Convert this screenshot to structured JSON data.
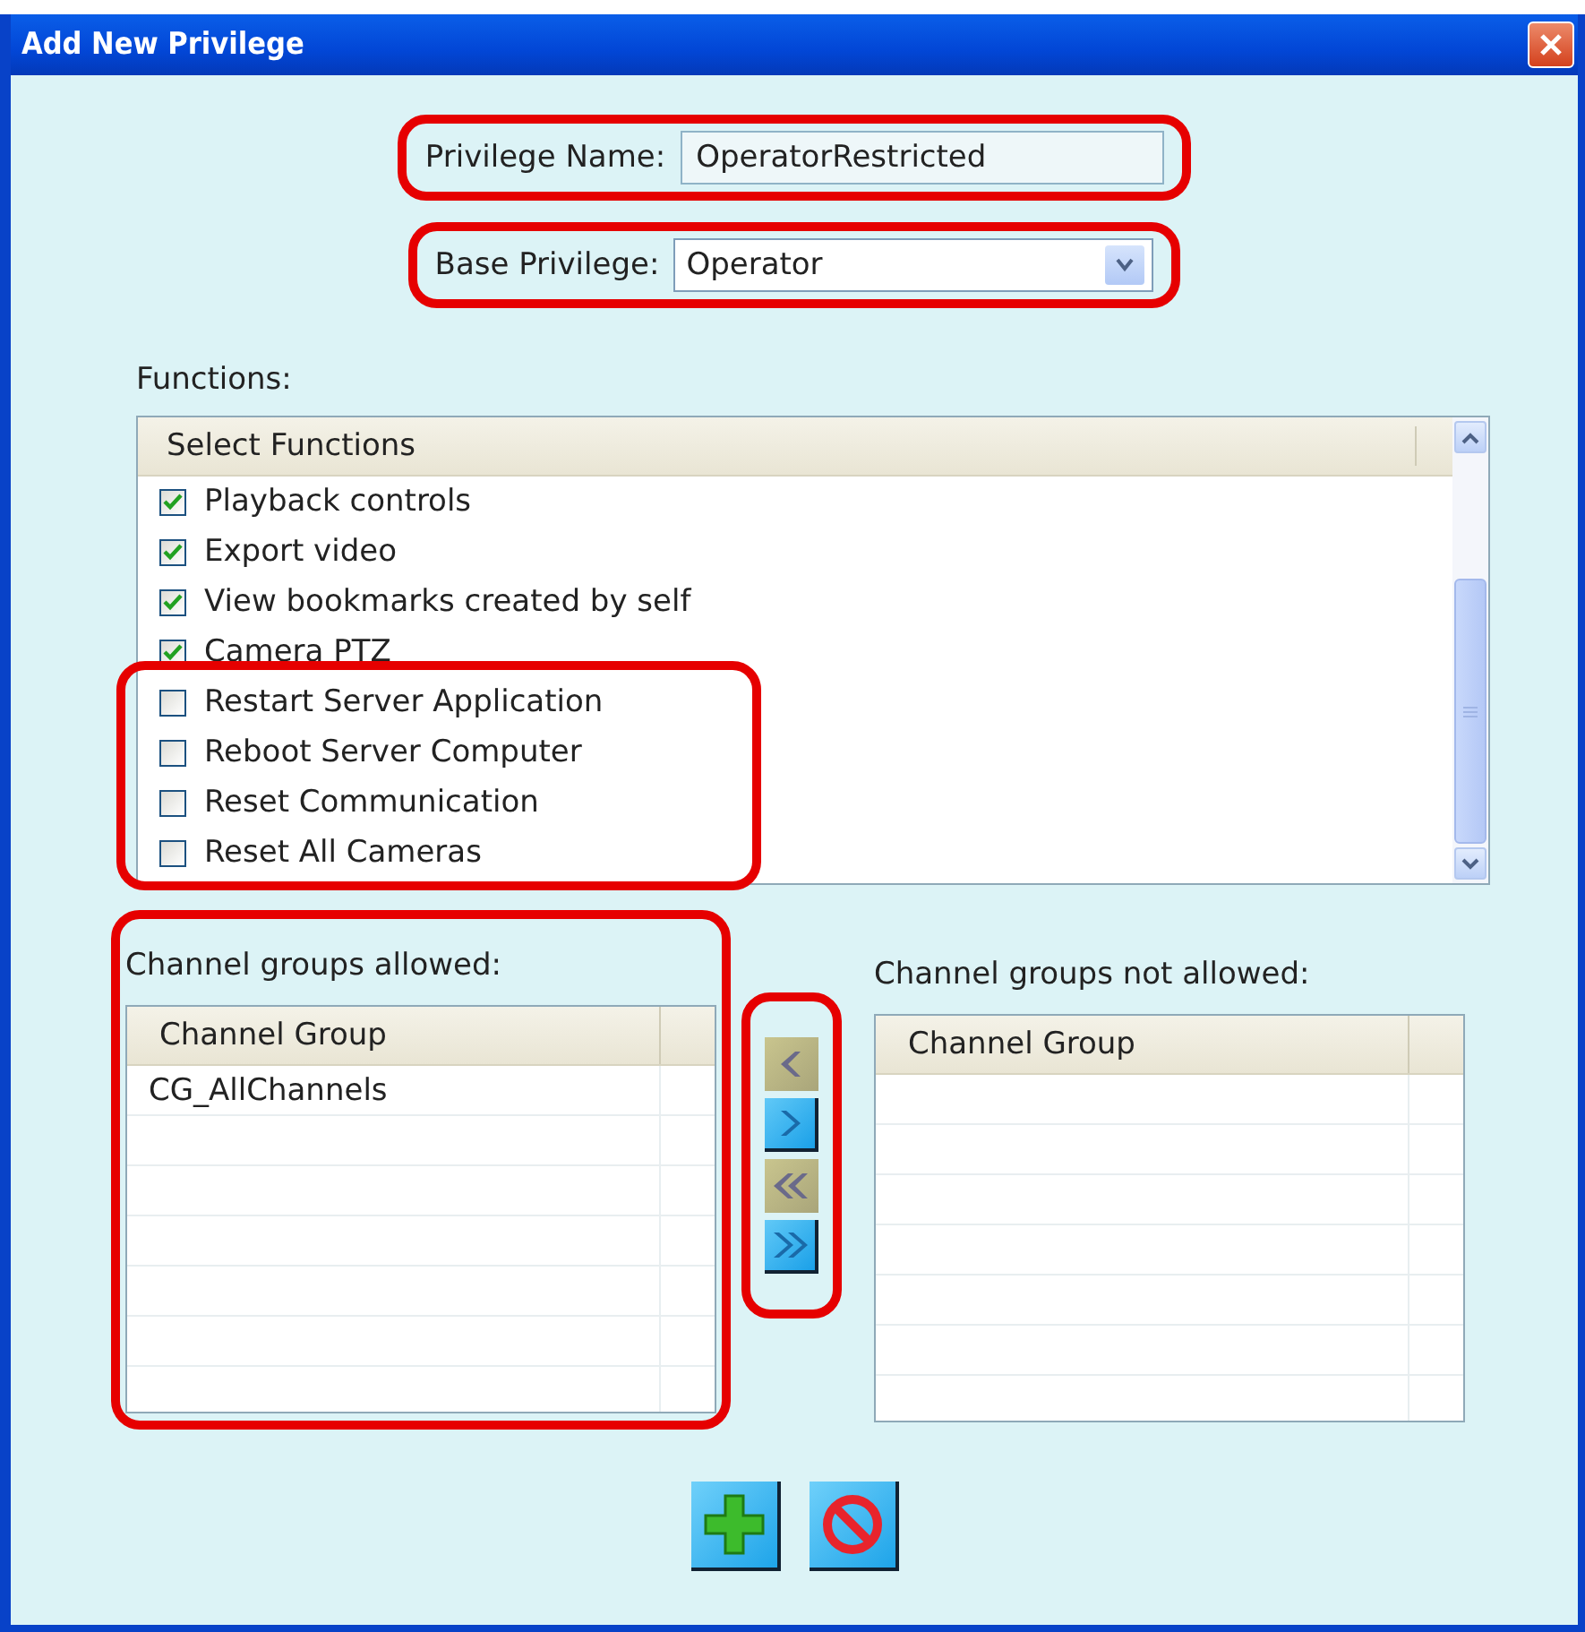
{
  "window": {
    "title": "Add New Privilege"
  },
  "privilege_name": {
    "label": "Privilege Name:",
    "value": "OperatorRestricted",
    "highlighted": true
  },
  "base_privilege": {
    "label": "Base Privilege:",
    "value": "Operator",
    "highlighted": true
  },
  "functions": {
    "label": "Functions:",
    "header": "Select Functions",
    "items": [
      {
        "label": "Playback controls",
        "checked": true,
        "highlighted": false
      },
      {
        "label": "Export video",
        "checked": true,
        "highlighted": false
      },
      {
        "label": "View bookmarks created by self",
        "checked": true,
        "highlighted": false
      },
      {
        "label": "Camera PTZ",
        "checked": true,
        "highlighted": false
      },
      {
        "label": "Restart Server Application",
        "checked": false,
        "highlighted": true
      },
      {
        "label": "Reboot Server Computer",
        "checked": false,
        "highlighted": true
      },
      {
        "label": "Reset Communication",
        "checked": false,
        "highlighted": true
      },
      {
        "label": "Reset All Cameras",
        "checked": false,
        "highlighted": true
      }
    ]
  },
  "channel_groups_allowed": {
    "label": "Channel groups allowed:",
    "column": "Channel Group",
    "rows": [
      "CG_AllChannels"
    ],
    "highlighted": true
  },
  "transfer_buttons": {
    "highlighted": true,
    "items": [
      {
        "kind": "left",
        "disabled": true
      },
      {
        "kind": "right",
        "disabled": false
      },
      {
        "kind": "left-all",
        "disabled": true
      },
      {
        "kind": "right-all",
        "disabled": false
      }
    ]
  },
  "channel_groups_not_allowed": {
    "label": "Channel groups not allowed:",
    "column": "Channel Group",
    "highlighted": false
  },
  "actions": [
    {
      "kind": "add"
    },
    {
      "kind": "cancel"
    }
  ]
}
